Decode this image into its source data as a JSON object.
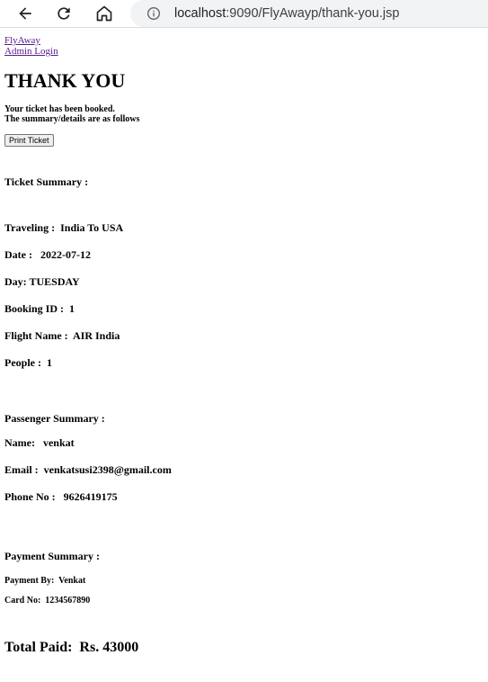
{
  "browser": {
    "url_host": "localhost",
    "url_rest": ":9090/FlyAwayp/thank-you.jsp"
  },
  "nav": {
    "home_link": "FlyAway",
    "admin_link": "Admin Login"
  },
  "page": {
    "title": "THANK YOU",
    "message_line1": "Your ticket has been booked.",
    "message_line2": "The summary/details are as follows",
    "print_button": "Print Ticket"
  },
  "ticket": {
    "heading": "Ticket Summary :",
    "traveling_label": "Traveling :",
    "traveling_value": "India To USA",
    "date_label": "Date :",
    "date_value": "2022-07-12",
    "day_label": "Day:",
    "day_value": "TUESDAY",
    "booking_label": "Booking ID :",
    "booking_value": "1",
    "flight_label": "Flight Name :",
    "flight_value": "AIR India",
    "people_label": "People :",
    "people_value": "1"
  },
  "passenger": {
    "heading": "Passenger Summary :",
    "name_label": "Name:",
    "name_value": "venkat",
    "email_label": "Email :",
    "email_value": "venkatsusi2398@gmail.com",
    "phone_label": "Phone No :",
    "phone_value": "9626419175"
  },
  "payment": {
    "heading": "Payment Summary :",
    "by_label": "Payment By:",
    "by_value": "Venkat",
    "card_label": "Card No:",
    "card_value": "1234567890",
    "total_label": "Total Paid:",
    "total_value": "Rs. 43000"
  }
}
